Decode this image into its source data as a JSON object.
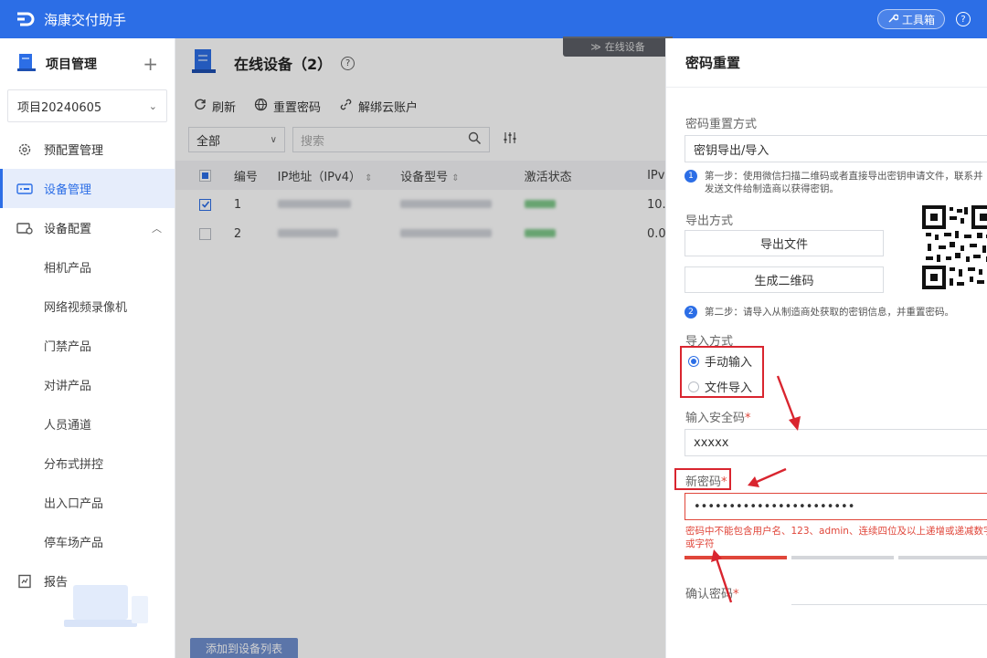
{
  "app": {
    "title": "海康交付助手"
  },
  "topbar": {
    "toolbox_label": "工具箱"
  },
  "sidebar": {
    "project_header": "项目管理",
    "project_selected": "项目20240605",
    "items": [
      {
        "label": "预配置管理"
      },
      {
        "label": "设备管理"
      },
      {
        "label": "设备配置"
      }
    ],
    "sub_items": [
      "相机产品",
      "网络视频录像机",
      "门禁产品",
      "对讲产品",
      "人员通道",
      "分布式拼控",
      "出入口产品",
      "停车场产品"
    ],
    "report_label": "报告"
  },
  "main": {
    "title": "在线设备（2）",
    "online_tab": "在线设备",
    "actions": {
      "refresh": "刷新",
      "reset_password": "重置密码",
      "unbind": "解绑云账户"
    },
    "filter_value": "全部",
    "search_placeholder": "搜索",
    "table": {
      "headers": [
        "编号",
        "IP地址（IPv4）",
        "设备型号",
        "激活状态",
        "IPv"
      ],
      "rows": [
        {
          "no": "1",
          "ipv_partial": "10.",
          "checked": true
        },
        {
          "no": "2",
          "ipv_partial": "0.0",
          "checked": false
        }
      ]
    },
    "add_button": "添加到设备列表"
  },
  "drawer": {
    "title": "密码重置",
    "reset_method_label": "密码重置方式",
    "reset_method_value": "密钥导出/导入",
    "step1_no": "1",
    "step1_text": "第一步：使用微信扫描二维码或者直接导出密钥申请文件，联系并发送文件给制造商以获得密钥。",
    "export_label": "导出方式",
    "export_file": "导出文件",
    "gen_qr": "生成二维码",
    "step2_no": "2",
    "step2_text": "第二步：请导入从制造商处获取的密钥信息，并重置密码。",
    "import_label": "导入方式",
    "manual_input": "手动输入",
    "file_import": "文件导入",
    "security_code_label": "输入安全码",
    "security_code_value": "xxxxx",
    "new_password_label": "新密码",
    "new_password_value": "•••••••••••••••••••••••",
    "password_error": "密码中不能包含用户名、123、admin、连续四位及以上递增或递减数字或字符",
    "confirm_label": "确认密码",
    "required_mark": "*"
  },
  "colors": {
    "primary": "#2c6ee6",
    "annotation_red": "#d9252f",
    "error_red": "#e0463a"
  }
}
